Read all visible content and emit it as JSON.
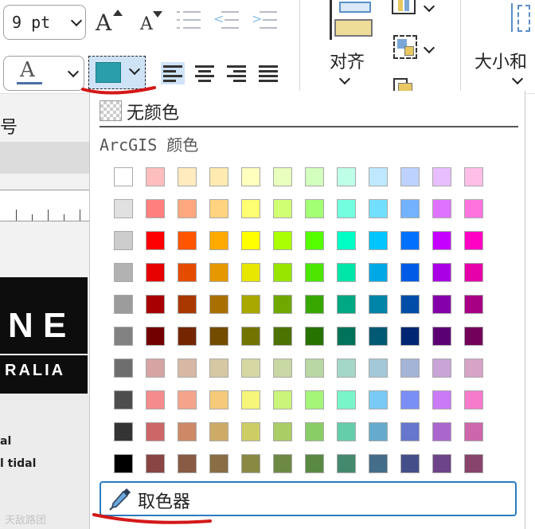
{
  "ribbon": {
    "font_size_value": "9 pt",
    "icons": [
      "grow-font-icon",
      "shrink-font-icon",
      "bullet-list-icon",
      "decrease-indent-icon",
      "increase-indent-icon",
      "font-color-icon",
      "align-left-icon",
      "align-center-icon",
      "align-right-icon",
      "justify-icon",
      "align-objects-icon",
      "size-position-icon"
    ],
    "align_group_label": "对齐",
    "size_group_label": "大小和",
    "fill_color": "#2a9fab"
  },
  "left_panel": {
    "side_label": "号",
    "banner_text_1": "N E",
    "banner_text_2": "RALIA",
    "map_label_1": "al",
    "map_label_2": "l tidal",
    "watermark": "天敌路团"
  },
  "color_menu": {
    "no_color_label": "无颜色",
    "palette_title": "ArcGIS 颜色",
    "color_picker_label": "取色器",
    "swatches": [
      [
        "#ffffff",
        "#ffbebe",
        "#ffebbe",
        "#ffebaf",
        "#ffffbe",
        "#e9ffbe",
        "#d3ffbe",
        "#beffe8",
        "#bee8ff",
        "#bed2ff",
        "#e8beff",
        "#ffbee8"
      ],
      [
        "#e1e1e1",
        "#ff7f7f",
        "#ffa77f",
        "#ffd37f",
        "#ffff73",
        "#d1ff73",
        "#a3ff73",
        "#73ffdf",
        "#73dfff",
        "#73b2ff",
        "#df73ff",
        "#ff73df"
      ],
      [
        "#cccccc",
        "#ff0000",
        "#ff5500",
        "#ffaa00",
        "#ffff00",
        "#aaff00",
        "#55ff00",
        "#00ffc5",
        "#00c5ff",
        "#0070ff",
        "#c500ff",
        "#ff00c5"
      ],
      [
        "#b2b2b2",
        "#e60000",
        "#e64c00",
        "#e69800",
        "#e6e600",
        "#98e600",
        "#4ce600",
        "#00e6a9",
        "#00a9e6",
        "#005ce6",
        "#a900e6",
        "#e600a9"
      ],
      [
        "#9c9c9c",
        "#a80000",
        "#a83800",
        "#a87000",
        "#a8a800",
        "#70a800",
        "#38a800",
        "#00a884",
        "#0084a8",
        "#004da8",
        "#8400a8",
        "#a80084"
      ],
      [
        "#828282",
        "#730000",
        "#732600",
        "#734c00",
        "#737300",
        "#4c7300",
        "#267300",
        "#00735a",
        "#005a73",
        "#002673",
        "#5a0073",
        "#73005a"
      ],
      [
        "#6e6e6e",
        "#d7a4a4",
        "#d7b8a4",
        "#d7c8a4",
        "#d7d7a4",
        "#c8d7a4",
        "#b8d7a4",
        "#a4d7c8",
        "#a4c8d7",
        "#a4b4d7",
        "#c8a4d7",
        "#d7a4c8"
      ],
      [
        "#4e4e4e",
        "#f58c8c",
        "#f5a48c",
        "#f5ca7a",
        "#f5f57a",
        "#caf57a",
        "#a4f57a",
        "#7af5ca",
        "#7acaf5",
        "#7a8ef5",
        "#ca7af5",
        "#f57aca"
      ],
      [
        "#343434",
        "#cd6666",
        "#cd8966",
        "#cdaa66",
        "#cdcd66",
        "#aacd66",
        "#89cd66",
        "#66cdab",
        "#66abcd",
        "#6677cd",
        "#ab66cd",
        "#cd66ab"
      ],
      [
        "#000000",
        "#894444",
        "#895a44",
        "#896d44",
        "#898944",
        "#6d8944",
        "#5a8944",
        "#44896e",
        "#446d89",
        "#444f89",
        "#6e4489",
        "#89446e"
      ]
    ]
  }
}
